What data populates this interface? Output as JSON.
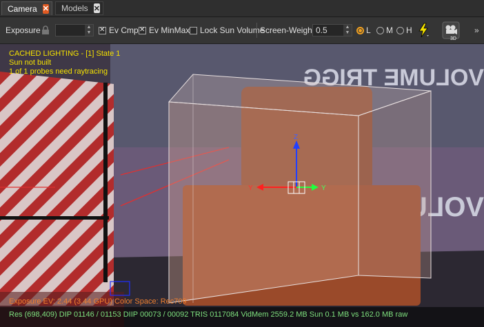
{
  "tabs": [
    {
      "label": "Camera",
      "active": true
    },
    {
      "label": "Models",
      "active": false
    }
  ],
  "toolbar": {
    "exposure_label": "Exposure",
    "exposure_value": "",
    "ev_cmp_label": "Ev Cmp",
    "ev_minmax_label": "Ev MinMax",
    "lock_sun_label": "Lock Sun Volume",
    "screen_weight_label": "Screen-Weight",
    "screen_weight_value": "0.5",
    "lod_options": [
      "L",
      "M",
      "H"
    ],
    "lod_selected": "L",
    "render_3d_label": "3D",
    "overflow_label": "»"
  },
  "overlay": {
    "line1": "CACHED LIGHTING - [1] State 1",
    "line2": "Sun not built",
    "line3": "1 of 1 probes need raytracing"
  },
  "gizmo": {
    "z": "Z",
    "y": "Y",
    "x": "Y"
  },
  "stats": {
    "exposure_line": "Exposure EV: 2.44 (3.44 GPU)  Color Space: Rec709",
    "perf_line": "Res (698,409)   DIP 01146 / 01153   DIIP 00073 / 00092   TRIS 0117084   VidMem 2559.2 MB    Sun 0.1 MB vs 162.0 MB raw"
  },
  "wall_text": "VOLUME TRIGG",
  "colors": {
    "accent": "#e05a22",
    "overlay_yellow": "#f5e200",
    "stat_green": "#7ee07e",
    "stat_orange": "#f08030"
  }
}
